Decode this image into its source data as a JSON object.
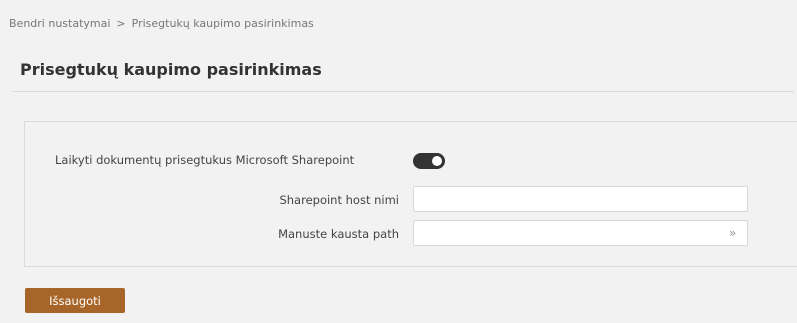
{
  "breadcrumb": {
    "items": [
      "Bendri nustatymai",
      "Prisegtukų kaupimo pasirinkimas"
    ],
    "separator": ">"
  },
  "page": {
    "title": "Prisegtukų kaupimo pasirinkimas"
  },
  "form": {
    "sharepoint_toggle": {
      "label": "Laikyti dokumentų prisegtukus Microsoft Sharepoint",
      "enabled": true
    },
    "host_name": {
      "label": "Sharepoint host nimi",
      "value": "",
      "placeholder": ""
    },
    "folder_path": {
      "label": "Manuste kausta path",
      "value": "",
      "placeholder": "",
      "icon": "double-chevron-right-icon"
    }
  },
  "actions": {
    "save_label": "Išsaugoti"
  },
  "colors": {
    "background": "#f2f2f2",
    "save_button": "#a8652a",
    "toggle_on": "#333333"
  }
}
